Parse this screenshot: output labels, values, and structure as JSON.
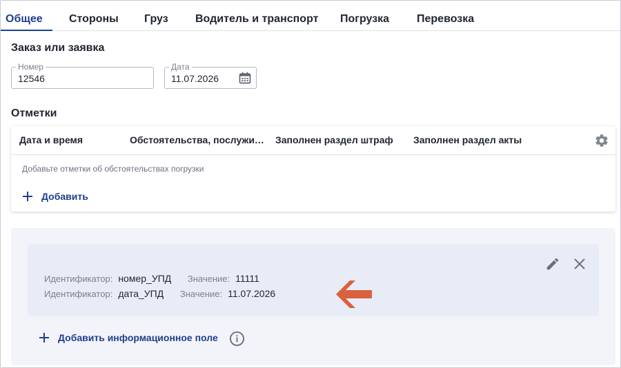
{
  "tabs": [
    {
      "label": "Общее",
      "active": true
    },
    {
      "label": "Стороны",
      "active": false
    },
    {
      "label": "Груз",
      "active": false
    },
    {
      "label": "Водитель и транспорт",
      "active": false
    },
    {
      "label": "Погрузка",
      "active": false
    },
    {
      "label": "Перевозка",
      "active": false
    }
  ],
  "order": {
    "title": "Заказ или заявка",
    "number": {
      "label": "Номер",
      "value": "12546"
    },
    "date": {
      "label": "Дата",
      "value": "11.07.2026",
      "icon": "calendar-icon"
    }
  },
  "marks": {
    "title": "Отметки",
    "columns": [
      "Дата и время",
      "Обстоятельства, послужи…",
      "Заполнен раздел штраф",
      "Заполнен раздел акты"
    ],
    "settings_icon": "gear-icon",
    "empty_hint": "Добавьте отметки об обстоятельствах погрузки",
    "add_label": "Добавить"
  },
  "info_fields": {
    "rows": [
      {
        "id_label": "Идентификатор:",
        "id_value": "номер_УПД",
        "val_label": "Значение:",
        "val_value": "11111"
      },
      {
        "id_label": "Идентификатор:",
        "id_value": "дата_УПД",
        "val_label": "Значение:",
        "val_value": "11.07.2026"
      }
    ],
    "add_label": "Добавить информационное поле",
    "icons": [
      "pencil-icon",
      "close-icon",
      "arrow-left-icon",
      "info-icon"
    ]
  },
  "colors": {
    "accent": "#1d3f8c",
    "arrow": "#d9623e",
    "panel_bg": "#f3f4f9",
    "card_bg": "#e8ecf7"
  }
}
